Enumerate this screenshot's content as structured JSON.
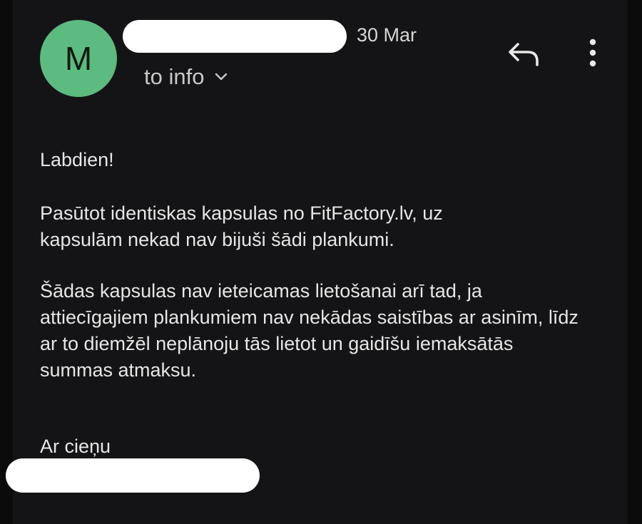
{
  "header": {
    "avatar_letter": "M",
    "date": "30 Mar",
    "recipient_label": "to info"
  },
  "icons": {
    "reply": "reply-icon",
    "more": "more-vertical-icon",
    "expand": "chevron-down-icon"
  },
  "body": {
    "greeting": "Labdien!",
    "paragraph1": "Pasūtot identiskas kapsulas no FitFactory.lv, uz kapsulām nekad nav bijuši šādi plankumi.",
    "paragraph2": "Šādas kapsulas nav ieteicamas lietošanai arī tad, ja attiecīgajiem plankumiem nav nekādas saistības ar asinīm, līdz ar to diemžēl neplānoju tās lietot un gaidīšu iemaksātās summas atmaksu.",
    "signoff": "Ar cieņu"
  },
  "colors": {
    "background": "#141416",
    "avatar": "#5cbb7f",
    "text": "#e6e6e6"
  }
}
